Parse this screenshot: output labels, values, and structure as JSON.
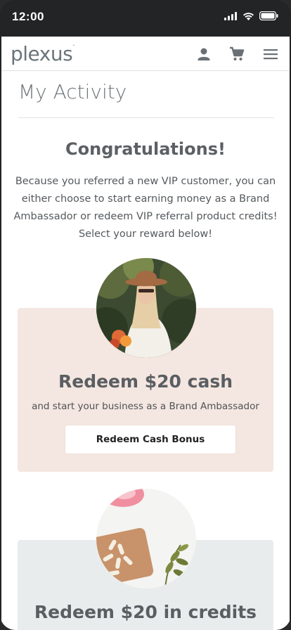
{
  "status_bar": {
    "time": "12:00",
    "icons": [
      "signal-icon",
      "wifi-icon",
      "battery-icon"
    ]
  },
  "navbar": {
    "logo": "plexus",
    "icons": [
      "user-icon",
      "cart-icon",
      "menu-icon"
    ]
  },
  "page": {
    "title": "My Activity",
    "heading": "Congratulations!",
    "intro": "Because you referred a new VIP customer, you can either choose to start earning money as a Brand Ambassador or redeem VIP referral product credits! Select your reward below!"
  },
  "cards": [
    {
      "title": "Redeem $20 cash",
      "subtitle": "and start your business as a Brand Ambassador",
      "button_label": "Redeem Cash Bonus",
      "background": "#f4e6e0"
    },
    {
      "title": "Redeem $20 in credits",
      "background": "#e9ecec"
    }
  ],
  "colors": {
    "text_dark": "#5a5e62",
    "logo": "#6a7479"
  }
}
